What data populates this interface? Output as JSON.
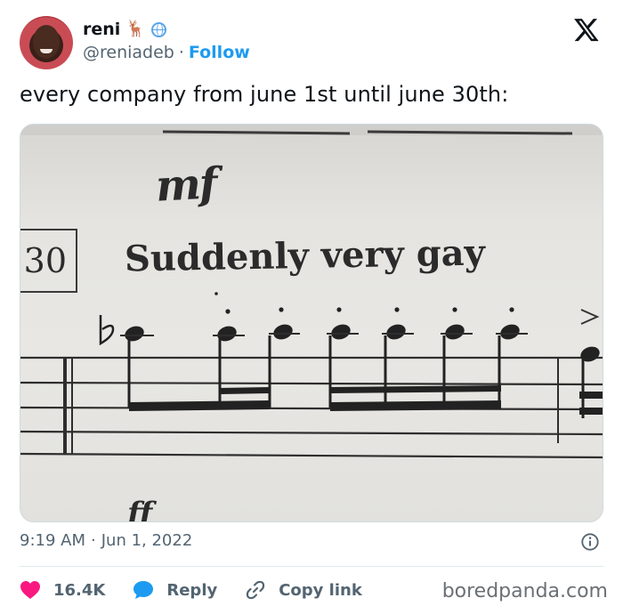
{
  "author": {
    "name": "reni",
    "name_emoji": "🦌",
    "handle": "@reniadeb",
    "separator": "·",
    "follow_label": "Follow"
  },
  "tweet": {
    "text": "every company from june 1st until june 30th:"
  },
  "image": {
    "dynamic_mark": "mf",
    "measure_number": "30",
    "caption": "Suddenly very gay"
  },
  "meta": {
    "time": "9:19 AM",
    "separator": "·",
    "date": "Jun 1, 2022"
  },
  "actions": {
    "likes": "16.4K",
    "reply_label": "Reply",
    "copy_link_label": "Copy link"
  },
  "watermark": "boredpanda.com",
  "colors": {
    "accent": "#1d9bf0",
    "like": "#f91880",
    "text": "#0f1419",
    "muted": "#536471"
  },
  "icons": [
    "x-logo-icon",
    "globe-icon",
    "info-icon",
    "heart-icon",
    "reply-bubble-icon",
    "link-icon"
  ]
}
